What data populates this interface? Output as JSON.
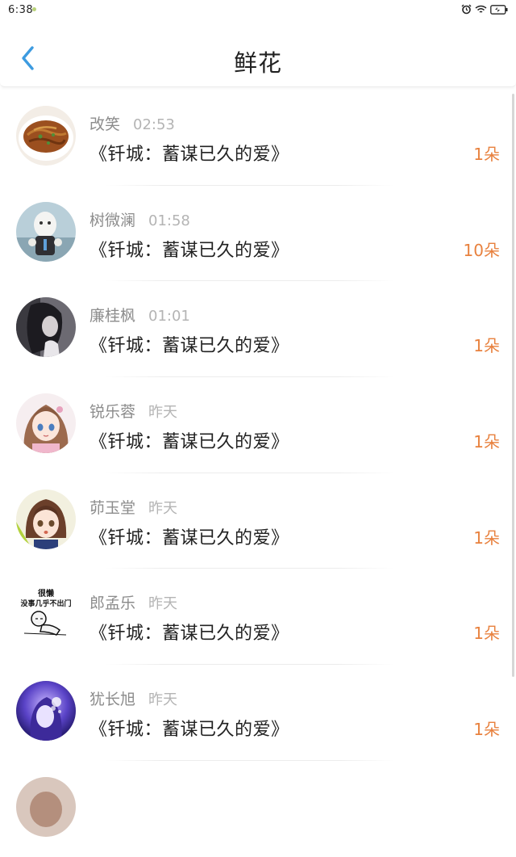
{
  "status_bar": {
    "time": "6:38"
  },
  "nav": {
    "title": "鲜花"
  },
  "items": [
    {
      "name": "改笑",
      "time": "02:53",
      "book": "《钎城：蓄谋已久的爱》",
      "count": "1朵",
      "avatar": "fried-noodles-avatar-icon"
    },
    {
      "name": "树微澜",
      "time": "01:58",
      "book": "《钎城：蓄谋已久的爱》",
      "count": "10朵",
      "avatar": "cartoon-character-avatar-icon"
    },
    {
      "name": "廉桂枫",
      "time": "01:01",
      "book": "《钎城：蓄谋已久的爱》",
      "count": "1朵",
      "avatar": "person-photo-avatar-icon"
    },
    {
      "name": "锐乐蓉",
      "time": "昨天",
      "book": "《钎城：蓄谋已久的爱》",
      "count": "1朵",
      "avatar": "anime-girl-avatar-icon"
    },
    {
      "name": "茆玉堂",
      "time": "昨天",
      "book": "《钎城：蓄谋已久的爱》",
      "count": "1朵",
      "avatar": "anime-girl-brown-hair-avatar-icon"
    },
    {
      "name": "郎孟乐",
      "time": "昨天",
      "book": "《钎城：蓄谋已久的爱》",
      "count": "1朵",
      "avatar": "meme-avatar-icon",
      "avatar_text": [
        "很懒",
        "没事几乎不出门"
      ]
    },
    {
      "name": "犹长旭",
      "time": "昨天",
      "book": "《钎城：蓄谋已久的爱》",
      "count": "1朵",
      "avatar": "anime-purple-avatar-icon"
    }
  ],
  "colors": {
    "accent": "#e8813e",
    "back": "#3d9be0"
  }
}
